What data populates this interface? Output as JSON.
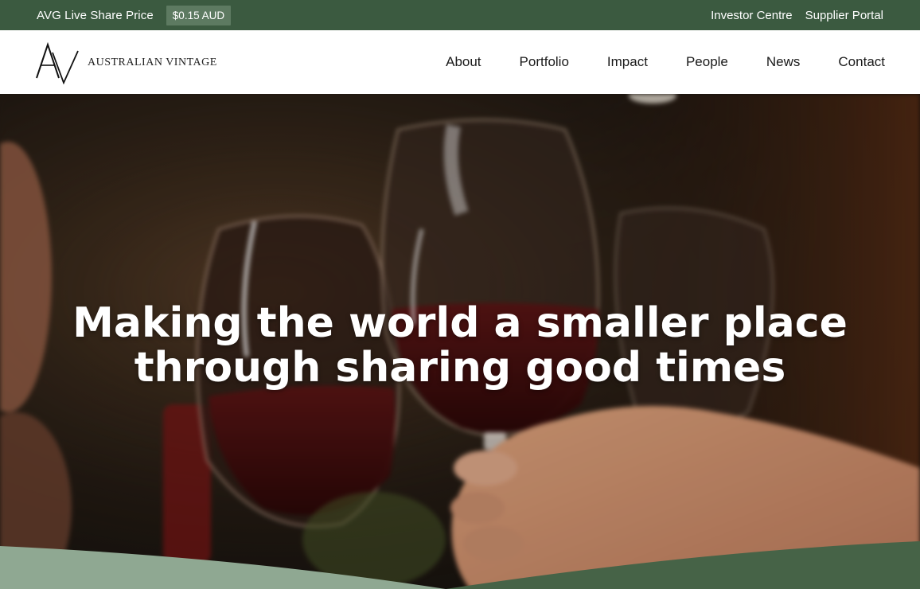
{
  "topbar": {
    "share_label": "AVG Live Share Price",
    "share_price": "$0.15 AUD",
    "links": [
      "Investor Centre",
      "Supplier Portal"
    ]
  },
  "header": {
    "logo_text": "AUSTRALIAN VINTAGE",
    "logo_monogram": "AV",
    "nav": [
      "About",
      "Portfolio",
      "Impact",
      "People",
      "News",
      "Contact"
    ]
  },
  "hero": {
    "headline_line1": "Making the world a smaller place",
    "headline_line2": "through sharing good times",
    "image_description_icon": "wine-glasses-toast-photo"
  },
  "colors": {
    "brand_green": "#3b5a40",
    "price_badge": "#5d7a61",
    "wave_light": "#8fa892",
    "wave_dark": "#466347"
  }
}
